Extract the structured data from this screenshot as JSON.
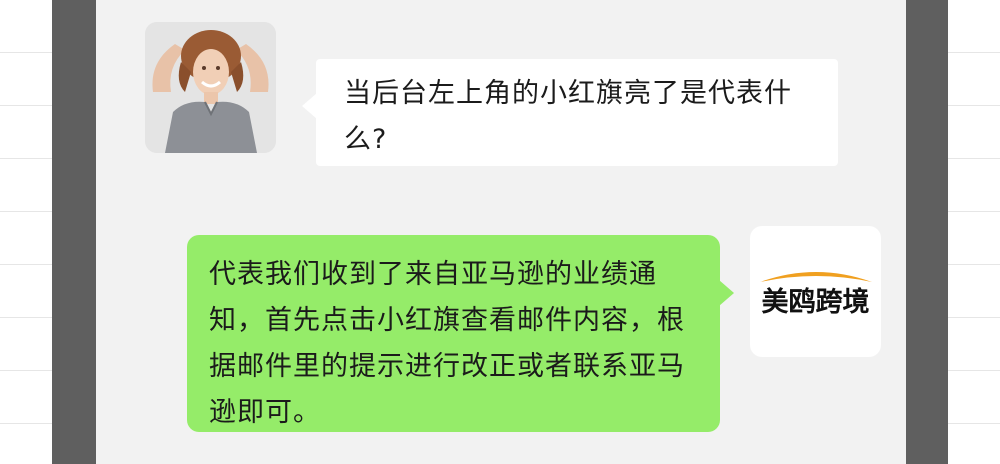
{
  "conversation": {
    "incoming_message": {
      "sender": "user",
      "text": "当后台左上角的小红旗亮了是代表什么?"
    },
    "outgoing_message": {
      "sender": "美鸥跨境",
      "text": "代表我们收到了来自亚马逊的业绩通知，首先点击小红旗查看邮件内容，根据邮件里的提示进行改正或者联系亚马逊即可。"
    }
  },
  "logo": {
    "text": "美鸥跨境",
    "accent_color": "#f0a020"
  },
  "colors": {
    "outgoing_bubble": "#95ec69",
    "incoming_bubble": "#ffffff",
    "chat_background": "#f2f2f2",
    "frame": "#5f5f5f"
  }
}
